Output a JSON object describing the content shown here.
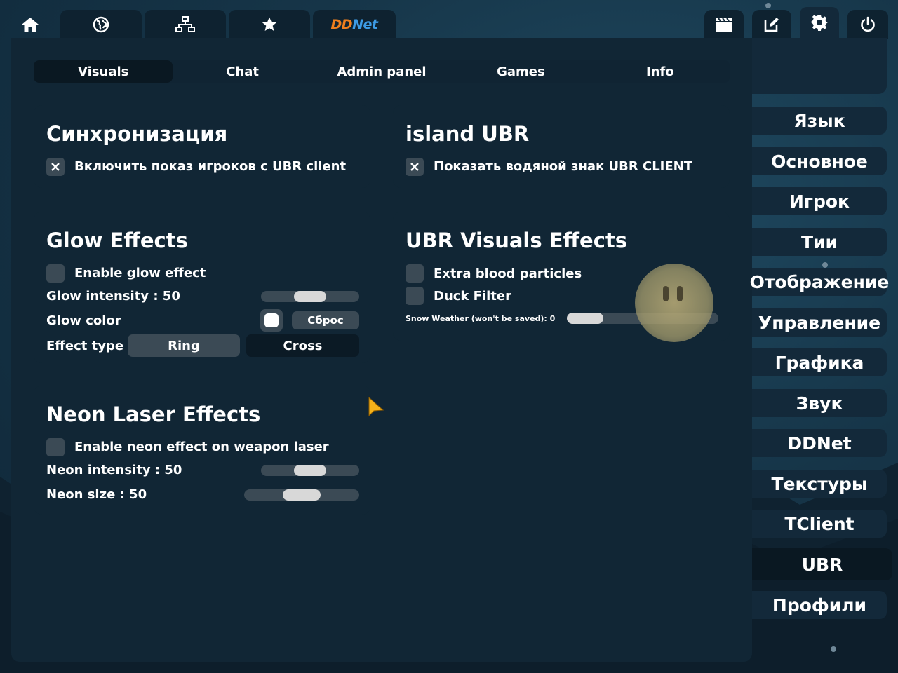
{
  "top_bar": {
    "buttons": [
      {
        "icon": "home-icon"
      },
      {
        "icon": "globe-icon"
      },
      {
        "icon": "network-icon"
      },
      {
        "icon": "star-icon"
      },
      {
        "icon": "ddnet-logo",
        "logo_dd": "DD",
        "logo_net": "Net"
      },
      {
        "icon": "demo-clapper-icon"
      },
      {
        "icon": "editor-icon"
      },
      {
        "icon": "gear-icon"
      },
      {
        "icon": "power-icon"
      }
    ],
    "active": "gear-icon"
  },
  "tabs": [
    {
      "label": "Visuals",
      "active": true
    },
    {
      "label": "Chat"
    },
    {
      "label": "Admin panel"
    },
    {
      "label": "Games"
    },
    {
      "label": "Info"
    }
  ],
  "sync_card": {
    "title": "Синхронизация",
    "checkbox_label": "Включить показ игроков с UBR client",
    "checked": true
  },
  "island_card": {
    "title": "island UBR",
    "checkbox_label": "Показать водяной знак UBR CLIENT",
    "checked": true
  },
  "glow_card": {
    "title": "Glow Effects",
    "enable_label": "Enable glow effect",
    "intensity_label": "Glow intensity",
    "intensity_value": ": 50",
    "color_label": "Glow color",
    "reset_label": "Сброс",
    "effect_type_label": "Effect type",
    "effect_options": [
      "Ring",
      "Cross"
    ],
    "selected_effect": "Ring",
    "color": "#ffffff"
  },
  "neon_card": {
    "title": "Neon Laser Effects",
    "enable_label": "Enable neon effect on weapon laser",
    "intensity_label": "Neon intensity",
    "intensity_value": ": 50",
    "size_label": "Neon size",
    "size_value": ": 50"
  },
  "ubr_visuals_card": {
    "title": "UBR Visuals Effects",
    "blood_label": "Extra blood particles",
    "duck_label": "Duck Filter",
    "snow_label": "Snow Weather (won't be saved): 0",
    "snow_value": 0
  },
  "side_menu": [
    {
      "label": "Язык"
    },
    {
      "label": "Основное"
    },
    {
      "label": "Игрок"
    },
    {
      "label": "Тии"
    },
    {
      "label": "Отображение"
    },
    {
      "label": "Управление"
    },
    {
      "label": "Графика"
    },
    {
      "label": "Звук"
    },
    {
      "label": "DDNet"
    },
    {
      "label": "Текстуры"
    },
    {
      "label": "TClient"
    },
    {
      "label": "UBR",
      "active": true
    },
    {
      "label": "Профили"
    }
  ],
  "colors": {
    "accent_orange": "#ee7f1e",
    "accent_blue": "#3d9ce6",
    "panel": "#13293a",
    "control": "#3b4a55"
  }
}
